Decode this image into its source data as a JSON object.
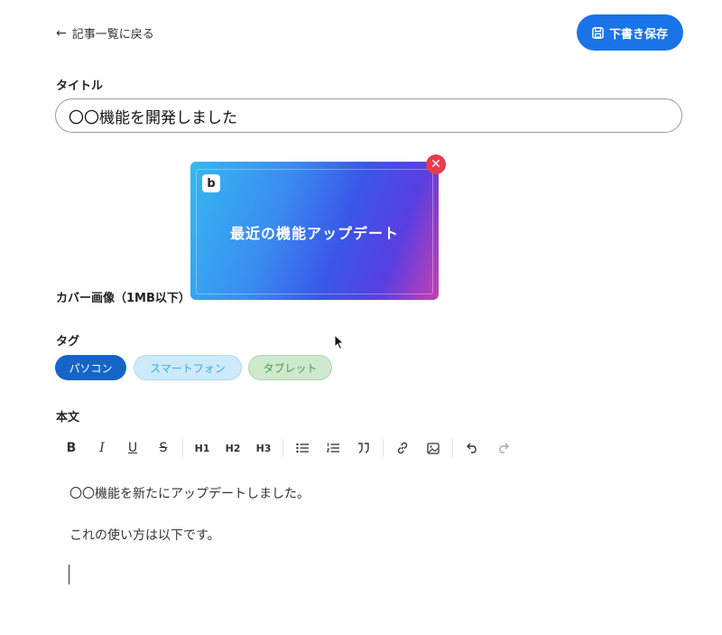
{
  "header": {
    "back_label": "記事一覧に戻る",
    "save_label": "下書き保存"
  },
  "title_field": {
    "label": "タイトル",
    "value": "〇〇機能を開発しました"
  },
  "cover": {
    "label": "カバー画像（1MB以下）",
    "image_text": "最近の機能アップデート",
    "logo_text": "b"
  },
  "tags": {
    "label": "タグ",
    "items": [
      {
        "label": "パソコン",
        "selected": true,
        "color": "#1565c8"
      },
      {
        "label": "スマートフォン",
        "selected": false,
        "color": "#3aa9e0"
      },
      {
        "label": "タブレット",
        "selected": false,
        "color": "#45a045"
      }
    ]
  },
  "editor": {
    "label": "本文",
    "toolbar": {
      "bold": "B",
      "italic": "I",
      "underline": "U",
      "strike": "S",
      "h1": "H1",
      "h2": "H2",
      "h3": "H3"
    },
    "paragraphs": [
      "〇〇機能を新たにアップデートしました。",
      "これの使い方は以下です。"
    ]
  },
  "colors": {
    "primary": "#1a73e8",
    "danger": "#ea3b4b"
  }
}
